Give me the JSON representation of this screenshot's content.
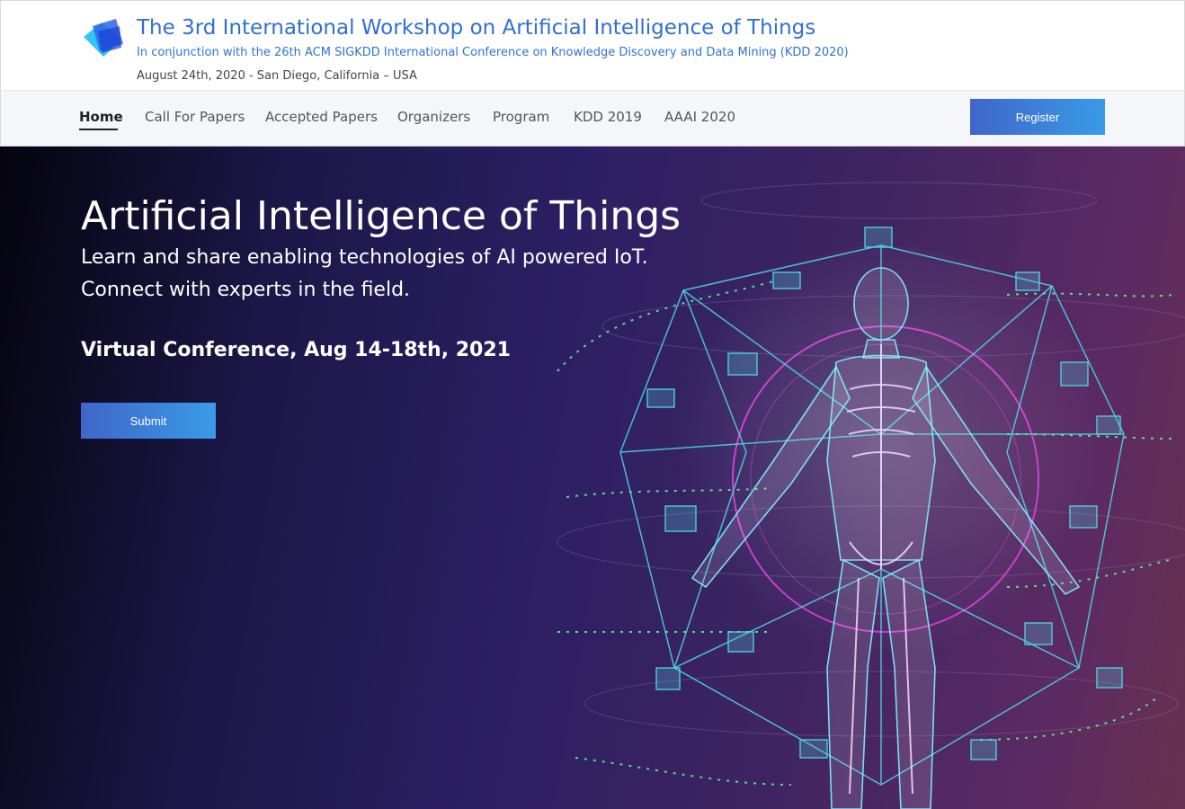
{
  "header": {
    "title": "The 3rd International Workshop on Artificial Intelligence of Things",
    "subtitle": "In conjunction with the 26th ACM SIGKDD International Conference on Knowledge Discovery and Data Mining (KDD 2020)",
    "dateline": "August 24th, 2020 - San Diego, California – USA",
    "logo_icon": "blue-square-stack-logo"
  },
  "nav": {
    "items": [
      {
        "label": "Home",
        "active": true
      },
      {
        "label": "Call For Papers",
        "active": false
      },
      {
        "label": "Accepted Papers",
        "active": false
      },
      {
        "label": "Organizers",
        "active": false
      },
      {
        "label": "Program",
        "active": false
      },
      {
        "label": "KDD 2019",
        "active": false
      },
      {
        "label": "AAAI 2020",
        "active": false
      }
    ],
    "register_label": "Register"
  },
  "hero": {
    "title": "Artificial Intelligence of Things",
    "line1": "Learn and share enabling technologies of AI powered IoT.",
    "line2": "Connect with experts in the field.",
    "event": "Virtual Conference, Aug 14-18th, 2021",
    "submit_label": "Submit",
    "image": "wireframe-human-body-iot-illustration"
  },
  "colors": {
    "title_blue": "#2f6fd6",
    "button_gradient_start": "#3f66c9",
    "button_gradient_end": "#3a9ae8",
    "nav_bg": "#f4f6f9",
    "hero_dark": "#1b1747",
    "hero_purple": "#5b2a63",
    "wire_cyan": "#4fd8e8",
    "wire_green": "#5cf28a",
    "wire_magenta": "#d63bd6"
  }
}
